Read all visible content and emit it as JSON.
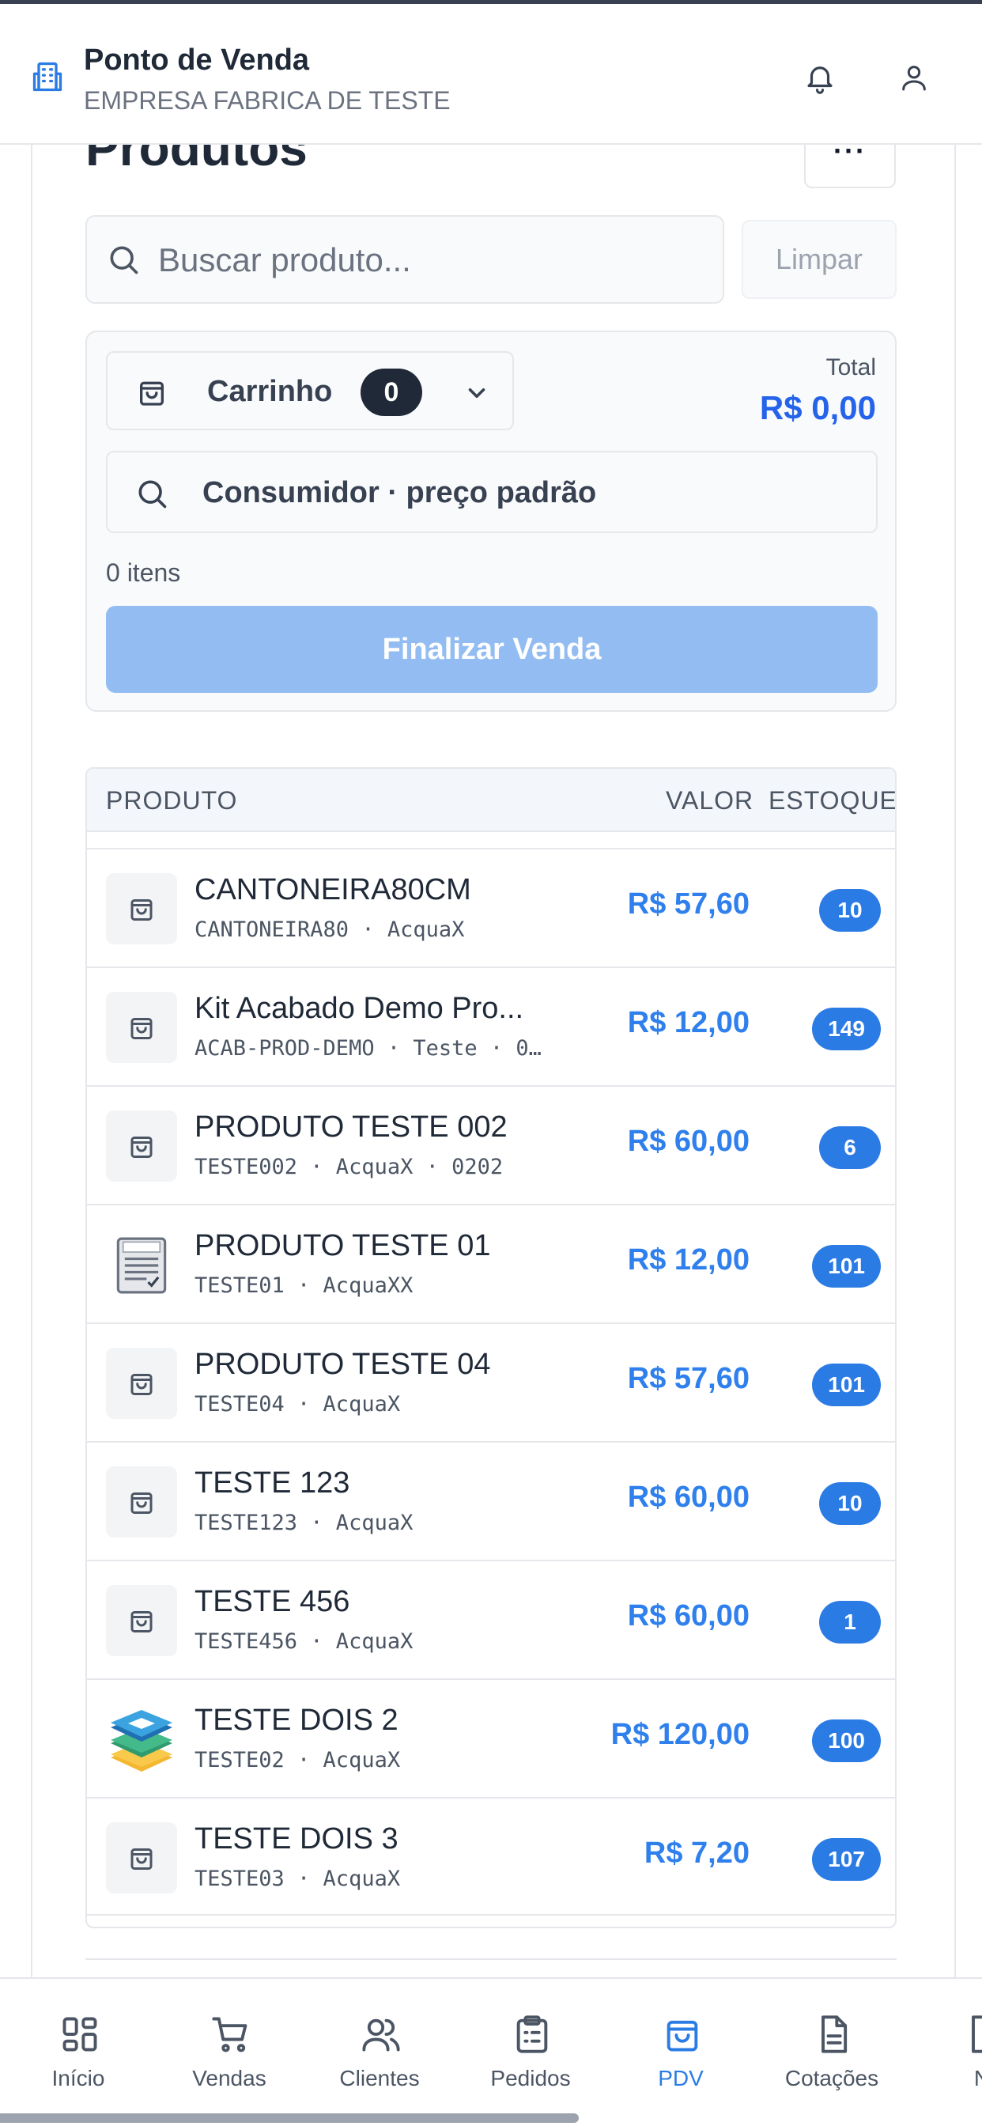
{
  "header": {
    "title": "Ponto de Venda",
    "company": "EMPRESA FABRICA DE TESTE"
  },
  "page": {
    "title": "Produtos",
    "more_label": "···"
  },
  "search": {
    "placeholder": "Buscar produto...",
    "clear_label": "Limpar"
  },
  "cart": {
    "label": "Carrinho",
    "count": "0",
    "total_label": "Total",
    "total_value": "R$ 0,00",
    "customer": "Consumidor · preço padrão",
    "items_count": "0 itens",
    "finalize_label": "Finalizar Venda"
  },
  "table": {
    "headers": {
      "product": "PRODUTO",
      "value": "VALOR",
      "stock": "ESTOQUE"
    },
    "rows": [
      {
        "name": "CANTONEIRA80CM",
        "sub": "CANTONEIRA80 · AcquaX",
        "value": "R$ 57,60",
        "stock": "10",
        "thumb": "bag-icon"
      },
      {
        "name": "Kit Acabado Demo Pro...",
        "sub": "ACAB-PROD-DEMO · Teste · 0…",
        "value": "R$ 12,00",
        "stock": "149",
        "thumb": "bag-icon"
      },
      {
        "name": "PRODUTO TESTE 002",
        "sub": "TESTE002 · AcquaX · 0202",
        "value": "R$ 60,00",
        "stock": "6",
        "thumb": "bag-icon"
      },
      {
        "name": "PRODUTO TESTE 01",
        "sub": "TESTE01 · AcquaXX",
        "value": "R$ 12,00",
        "stock": "101",
        "thumb": "test-document-icon"
      },
      {
        "name": "PRODUTO TESTE 04",
        "sub": "TESTE04 · AcquaX",
        "value": "R$ 57,60",
        "stock": "101",
        "thumb": "bag-icon"
      },
      {
        "name": "TESTE 123",
        "sub": "TESTE123 · AcquaX",
        "value": "R$ 60,00",
        "stock": "10",
        "thumb": "bag-icon"
      },
      {
        "name": "TESTE 456",
        "sub": "TESTE456 · AcquaX",
        "value": "R$ 60,00",
        "stock": "1",
        "thumb": "bag-icon"
      },
      {
        "name": "TESTE DOIS 2",
        "sub": "TESTE02 · AcquaX",
        "value": "R$ 120,00",
        "stock": "100",
        "thumb": "layers-stack-icon"
      },
      {
        "name": "TESTE DOIS 3",
        "sub": "TESTE03 · AcquaX",
        "value": "R$ 7,20",
        "stock": "107",
        "thumb": "bag-icon"
      }
    ]
  },
  "nav": {
    "items": [
      {
        "label": "Início",
        "icon": "grid-icon"
      },
      {
        "label": "Vendas",
        "icon": "cart-icon"
      },
      {
        "label": "Clientes",
        "icon": "users-icon"
      },
      {
        "label": "Pedidos",
        "icon": "clipboard-icon"
      },
      {
        "label": "PDV",
        "icon": "bag-icon",
        "active": true
      },
      {
        "label": "Cotações",
        "icon": "document-icon"
      },
      {
        "label": "N",
        "icon": "document-icon"
      }
    ]
  },
  "colors": {
    "accent": "#2b7be5",
    "price": "#2f80ed",
    "finalize_disabled": "#93bdf2",
    "badge_dark": "#1f2937"
  }
}
